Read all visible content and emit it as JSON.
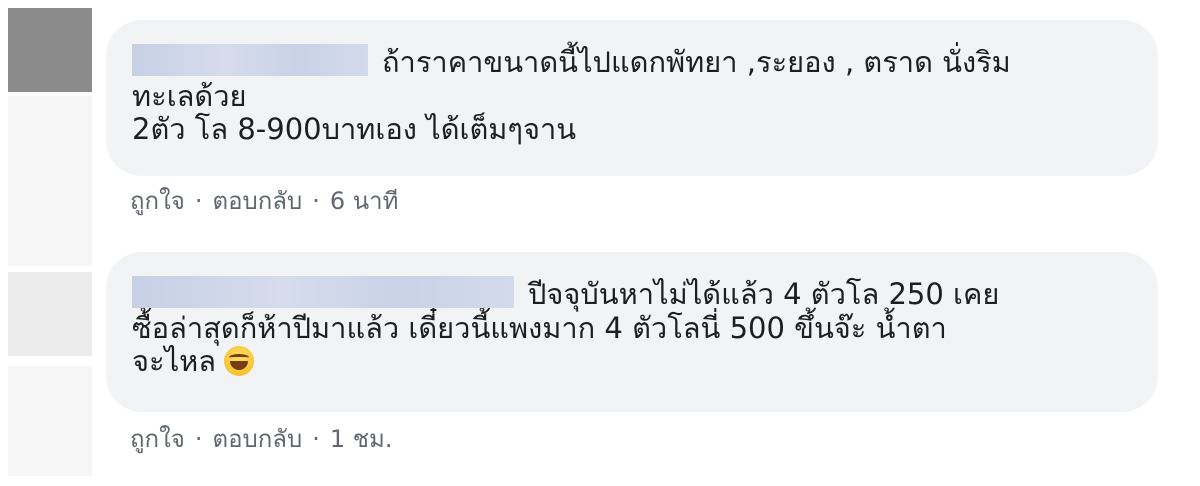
{
  "comments": [
    {
      "lines": [
        "ถ้าราคาขนาดนี้ไปแดกพัทยา ,ระยอง , ตราด นั่งริม",
        "ทะเลด้วย",
        "2ตัว โล 8-900บาทเอง ได้เต็มๆจาน"
      ],
      "emoji": "",
      "actions": {
        "like": "ถูกใจ",
        "reply": "ตอบกลับ",
        "time": "6 นาที"
      }
    },
    {
      "lines": [
        "ปีจจุบันหาไม่ได้แล้ว 4 ตัวโล 250 เคย",
        "ซื้อล่าสุดก็ห้าปีมาแล้ว เดี๋ยวนี้แพงมาก 4 ตัวโลนี่ 500 ขึ้นจ๊ะ น้ำตา",
        "จะไหล"
      ],
      "emoji": "laughing-tears-emoji",
      "actions": {
        "like": "ถูกใจ",
        "reply": "ตอบกลับ",
        "time": "1 ชม."
      }
    }
  ],
  "separator": "·"
}
